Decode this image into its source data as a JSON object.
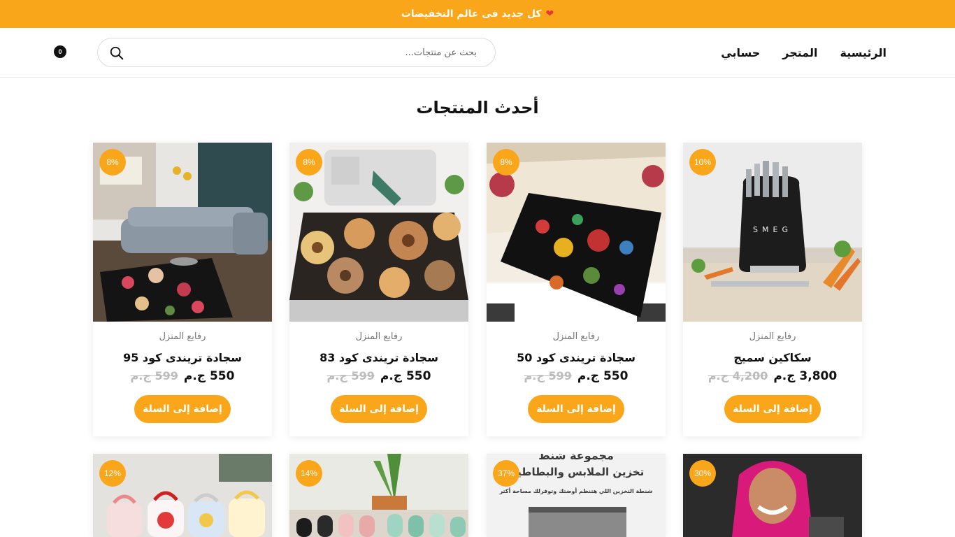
{
  "announcement": {
    "text": "كل جديد فى عالم التخفيضات",
    "icon": "heart-icon"
  },
  "nav": [
    "الرئيسية",
    "المتجر",
    "حسابي"
  ],
  "search": {
    "placeholder": "بحث عن منتجات..."
  },
  "cart": {
    "count": "0"
  },
  "section_title": "أحدث المنتجات",
  "colors": {
    "accent": "#f9a61a",
    "text": "#111111",
    "muted": "#777777"
  },
  "products": [
    {
      "discount": "10%",
      "category": "رفايع المنزل",
      "name": "سكاكين سميج",
      "price": "3,800 ج.م",
      "old_price": "4,200 ج.م",
      "button": "إضافة إلى السلة"
    },
    {
      "discount": "8%",
      "category": "رفايع المنزل",
      "name": "سجادة تريندى كود 50",
      "price": "550 ج.م",
      "old_price": "599 ج.م",
      "button": "إضافة إلى السلة"
    },
    {
      "discount": "8%",
      "category": "رفايع المنزل",
      "name": "سجادة تريندى كود 83",
      "price": "550 ج.م",
      "old_price": "599 ج.م",
      "button": "إضافة إلى السلة"
    },
    {
      "discount": "8%",
      "category": "رفايع المنزل",
      "name": "سجادة تريندى كود 95",
      "price": "550 ج.م",
      "old_price": "599 ج.م",
      "button": "إضافة إلى السلة"
    }
  ],
  "products_row2": [
    {
      "discount": "30%"
    },
    {
      "discount": "37%",
      "image_text_1": "مجموعة شنط",
      "image_text_2": "تخزين الملابس والبطاطين",
      "image_text_3": "شنطة التخزين اللي هتنظم أوضتك وتوفرلك مساحة أكتر"
    },
    {
      "discount": "14%"
    },
    {
      "discount": "12%"
    }
  ]
}
